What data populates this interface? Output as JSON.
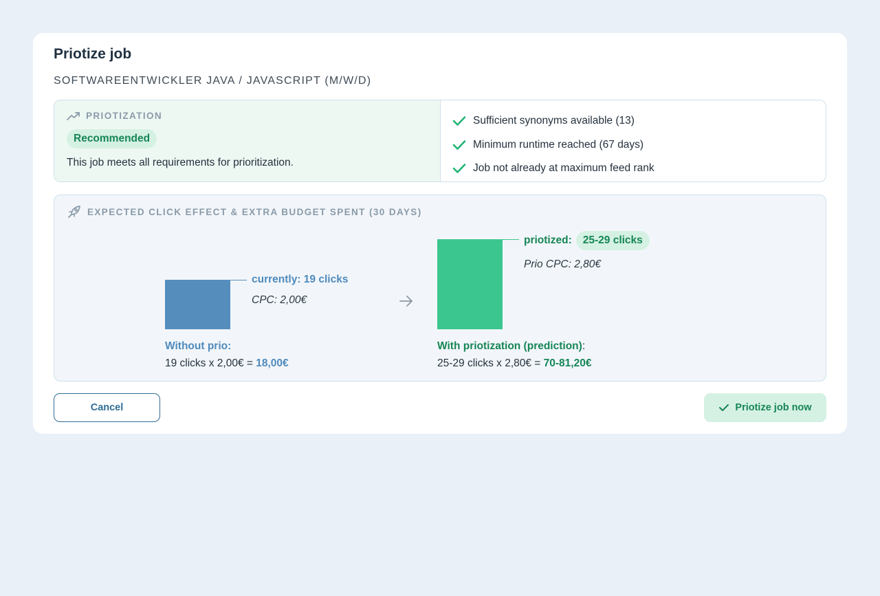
{
  "modal": {
    "title": "Priotize job",
    "job_title": "SOFTWAREENTWICKLER JAVA / JAVASCRIPT (M/W/D)"
  },
  "prioritization": {
    "section_label": "PRIOTIZATION",
    "badge": "Recommended",
    "description": "This job meets all requirements for prioritization.",
    "checks": [
      {
        "label": "Sufficient synonyms available (13)",
        "icon": "check-icon"
      },
      {
        "label": "Minimum runtime reached (67 days)",
        "icon": "check-icon"
      },
      {
        "label": "Job not already at maximum feed rank",
        "icon": "check-icon"
      }
    ]
  },
  "effect": {
    "section_label": "EXPECTED CLICK EFFECT & EXTRA BUDGET SPENT (30 DAYS)",
    "current": {
      "label": "currently: 19 clicks",
      "cpc": "CPC: 2,00€",
      "clicks": 19,
      "heading": "Without prio:",
      "calc_prefix": "19 clicks x 2,00€ = ",
      "result": "18,00€"
    },
    "prioritized": {
      "label_prefix": "priotized:",
      "label_value": "25-29 clicks",
      "cpc": "Prio CPC: 2,80€",
      "clicks_max": 29,
      "heading": "With priotization (prediction)",
      "heading_suffix": ":",
      "calc_prefix": "25-29 clicks x 2,80€ = ",
      "result": "70-81,20€"
    }
  },
  "buttons": {
    "cancel": "Cancel",
    "prioritize": "Priotize job now"
  },
  "colors": {
    "current": "#558dbd",
    "prioritized": "#3cc68f",
    "accent_green": "#168556",
    "accent_blue": "#2f6d96"
  }
}
